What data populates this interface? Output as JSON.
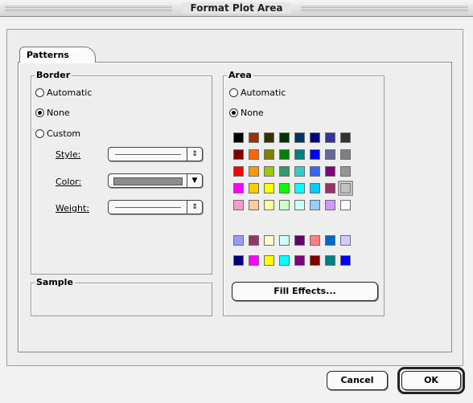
{
  "window": {
    "title": "Format Plot Area"
  },
  "tabs": [
    {
      "label": "Patterns"
    }
  ],
  "border": {
    "title": "Border",
    "options": [
      {
        "label": "Automatic",
        "selected": false
      },
      {
        "label": "None",
        "selected": true
      },
      {
        "label": "Custom",
        "selected": false
      }
    ],
    "style_label": "Style:",
    "color_label": "Color:",
    "weight_label": "Weight:",
    "style_arrow": "⇕",
    "color_arrow": "▼",
    "weight_arrow": "⇕"
  },
  "sample": {
    "title": "Sample"
  },
  "area": {
    "title": "Area",
    "options": [
      {
        "label": "Automatic",
        "selected": false
      },
      {
        "label": "None",
        "selected": true
      }
    ],
    "palette_main": [
      "#000000",
      "#993300",
      "#333300",
      "#003300",
      "#003366",
      "#000080",
      "#333399",
      "#333333",
      "#800000",
      "#FF6600",
      "#808000",
      "#008000",
      "#008080",
      "#0000FF",
      "#666699",
      "#808080",
      "#FF0000",
      "#FF9900",
      "#99CC00",
      "#339966",
      "#33CCCC",
      "#3366FF",
      "#800080",
      "#969696",
      "#FF00FF",
      "#FFCC00",
      "#FFFF00",
      "#00FF00",
      "#00FFFF",
      "#00CCFF",
      "#993366",
      "#C0C0C0",
      "#FF99CC",
      "#FFCC99",
      "#FFFF99",
      "#CCFFCC",
      "#CCFFFF",
      "#99CCFF",
      "#CC99FF",
      "#FFFFFF"
    ],
    "palette_chart": [
      "#9999FF",
      "#993366",
      "#FFFFCC",
      "#CCFFFF",
      "#660066",
      "#FF8080",
      "#0066CC",
      "#CCCCFF",
      "#000080",
      "#FF00FF",
      "#FFFF00",
      "#00FFFF",
      "#800080",
      "#800000",
      "#008080",
      "#0000FF"
    ],
    "fill_effects_label": "Fill Effects..."
  },
  "buttons": {
    "cancel": "Cancel",
    "ok": "OK"
  }
}
